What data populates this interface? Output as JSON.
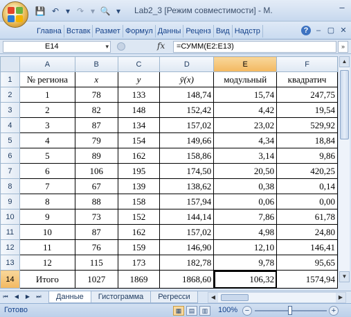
{
  "window": {
    "title": "Lab2_3  [Режим совместимости] - M.",
    "min_glyph": "–",
    "max_glyph": "▢",
    "close_glyph": "✕"
  },
  "quick_access": [
    {
      "name": "save-icon",
      "glyph": "💾"
    },
    {
      "name": "undo-icon",
      "glyph": "↶"
    },
    {
      "name": "undo-dropdown-icon",
      "glyph": "▾"
    },
    {
      "name": "redo-icon",
      "glyph": "↷"
    },
    {
      "name": "redo-dropdown-icon",
      "glyph": "▾"
    },
    {
      "name": "print-preview-icon",
      "glyph": "🔍"
    },
    {
      "name": "customize-qat-icon",
      "glyph": "▾"
    }
  ],
  "ribbon": {
    "tabs": [
      "Главна",
      "Вставк",
      "Размет",
      "Формул",
      "Данны",
      "Реценз",
      "Вид",
      "Надстр"
    ],
    "help_glyph": "?",
    "min_glyph": "–",
    "restore_glyph": "▢",
    "close_glyph": "✕"
  },
  "formula_bar": {
    "name_box": "E14",
    "fx_label": "fx",
    "formula": "=СУММ(E2:E13)",
    "dropdown_glyph": "▾",
    "expand_glyph": "»"
  },
  "sheet": {
    "columns": [
      "A",
      "B",
      "C",
      "D",
      "E",
      "F"
    ],
    "selected_column": "E",
    "selected_row": "14",
    "header_row": {
      "row_num": "1",
      "cells": [
        "№ региона",
        "x",
        "y",
        "ȳ(x)",
        "модульный",
        "квадратич"
      ]
    },
    "rows": [
      {
        "row_num": "2",
        "cells": [
          "1",
          "78",
          "133",
          "148,74",
          "15,74",
          "247,75"
        ]
      },
      {
        "row_num": "3",
        "cells": [
          "2",
          "82",
          "148",
          "152,42",
          "4,42",
          "19,54"
        ]
      },
      {
        "row_num": "4",
        "cells": [
          "3",
          "87",
          "134",
          "157,02",
          "23,02",
          "529,92"
        ]
      },
      {
        "row_num": "5",
        "cells": [
          "4",
          "79",
          "154",
          "149,66",
          "4,34",
          "18,84"
        ]
      },
      {
        "row_num": "6",
        "cells": [
          "5",
          "89",
          "162",
          "158,86",
          "3,14",
          "9,86"
        ]
      },
      {
        "row_num": "7",
        "cells": [
          "6",
          "106",
          "195",
          "174,50",
          "20,50",
          "420,25"
        ]
      },
      {
        "row_num": "8",
        "cells": [
          "7",
          "67",
          "139",
          "138,62",
          "0,38",
          "0,14"
        ]
      },
      {
        "row_num": "9",
        "cells": [
          "8",
          "88",
          "158",
          "157,94",
          "0,06",
          "0,00"
        ]
      },
      {
        "row_num": "10",
        "cells": [
          "9",
          "73",
          "152",
          "144,14",
          "7,86",
          "61,78"
        ]
      },
      {
        "row_num": "11",
        "cells": [
          "10",
          "87",
          "162",
          "157,02",
          "4,98",
          "24,80"
        ]
      },
      {
        "row_num": "12",
        "cells": [
          "11",
          "76",
          "159",
          "146,90",
          "12,10",
          "146,41"
        ]
      },
      {
        "row_num": "13",
        "cells": [
          "12",
          "115",
          "173",
          "182,78",
          "9,78",
          "95,65"
        ]
      }
    ],
    "total_row": {
      "row_num": "14",
      "cells": [
        "Итого",
        "1027",
        "1869",
        "1868,60",
        "106,32",
        "1574,94"
      ]
    }
  },
  "sheet_tabs": {
    "tabs": [
      "Данные",
      "Гистограмма",
      "Регресси"
    ],
    "active_index": 0,
    "nav": [
      "⏮",
      "◀",
      "▶",
      "⏭"
    ]
  },
  "status_bar": {
    "ready": "Готово",
    "zoom": "100%",
    "zoom_minus": "−",
    "zoom_plus": "+"
  },
  "colors": {
    "active_cell": "#fbd3a9",
    "selected_header": "#f3b860",
    "ribbon_bg": "#dbe6f4"
  }
}
